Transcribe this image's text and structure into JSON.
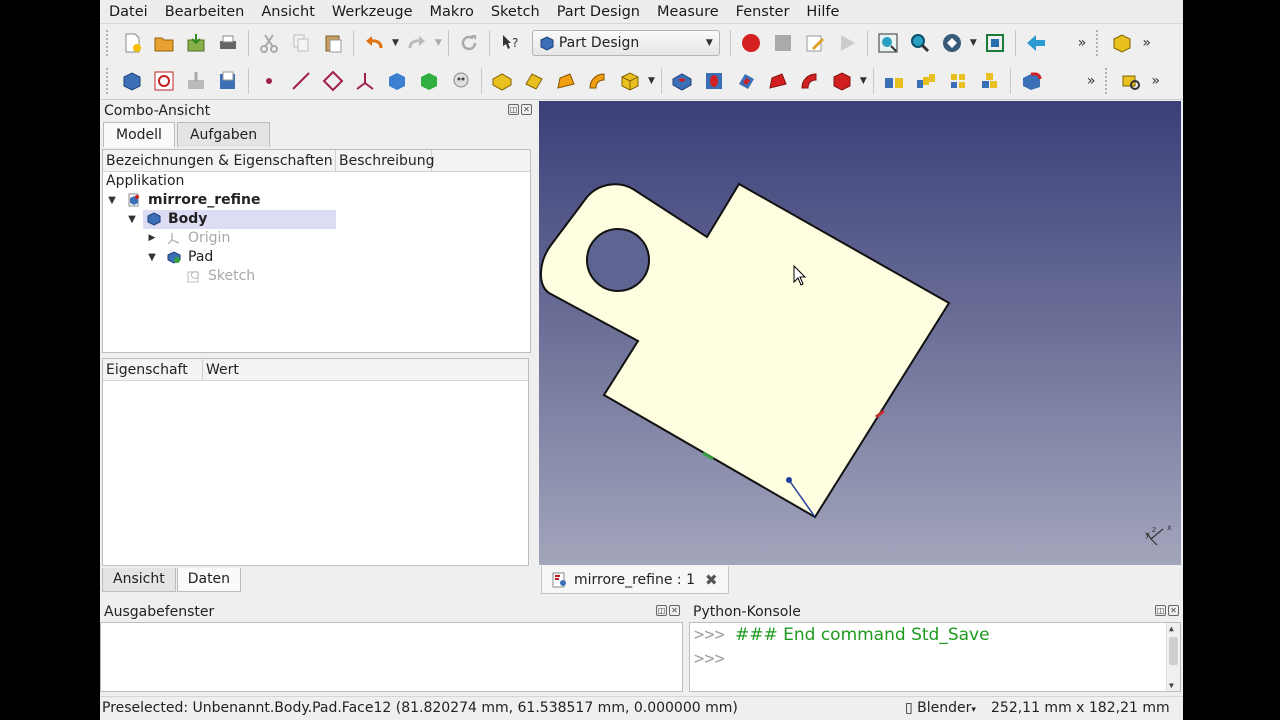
{
  "menu": [
    "Datei",
    "Bearbeiten",
    "Ansicht",
    "Werkzeuge",
    "Makro",
    "Sketch",
    "Part Design",
    "Measure",
    "Fenster",
    "Hilfe"
  ],
  "toolbar": {
    "workbench": "Part Design",
    "overflow": "»"
  },
  "combo": {
    "title": "Combo-Ansicht",
    "tabs": [
      "Modell",
      "Aufgaben"
    ],
    "tree_headers": [
      "Bezeichnungen & Eigenschaften",
      "Beschreibung"
    ],
    "tree": {
      "root": "Applikation",
      "document": "mirrore_refine",
      "body": "Body",
      "origin": "Origin",
      "pad": "Pad",
      "sketch": "Sketch"
    },
    "prop_headers": [
      "Eigenschaft",
      "Wert"
    ],
    "bottom_tabs": [
      "Ansicht",
      "Daten"
    ]
  },
  "document_tab": {
    "label": "mirrore_refine : 1"
  },
  "output": {
    "title": "Ausgabefenster"
  },
  "python": {
    "title": "Python-Konsole",
    "prompt": ">>>",
    "line1": "### End command Std_Save"
  },
  "status": {
    "message": "Preselected: Unbenannt.Body.Pad.Face12 (81.820274 mm, 61.538517 mm, 0.000000 mm)",
    "navigation": "Blender",
    "dimensions": "252,11 mm x 182,21 mm"
  },
  "colors": {
    "part_face": "#fffee0",
    "viewport_top": "#3a3f7a",
    "viewport_bottom": "#a3a5bc",
    "console_green": "#1e9a1e",
    "selection": "#dcdcf4"
  }
}
